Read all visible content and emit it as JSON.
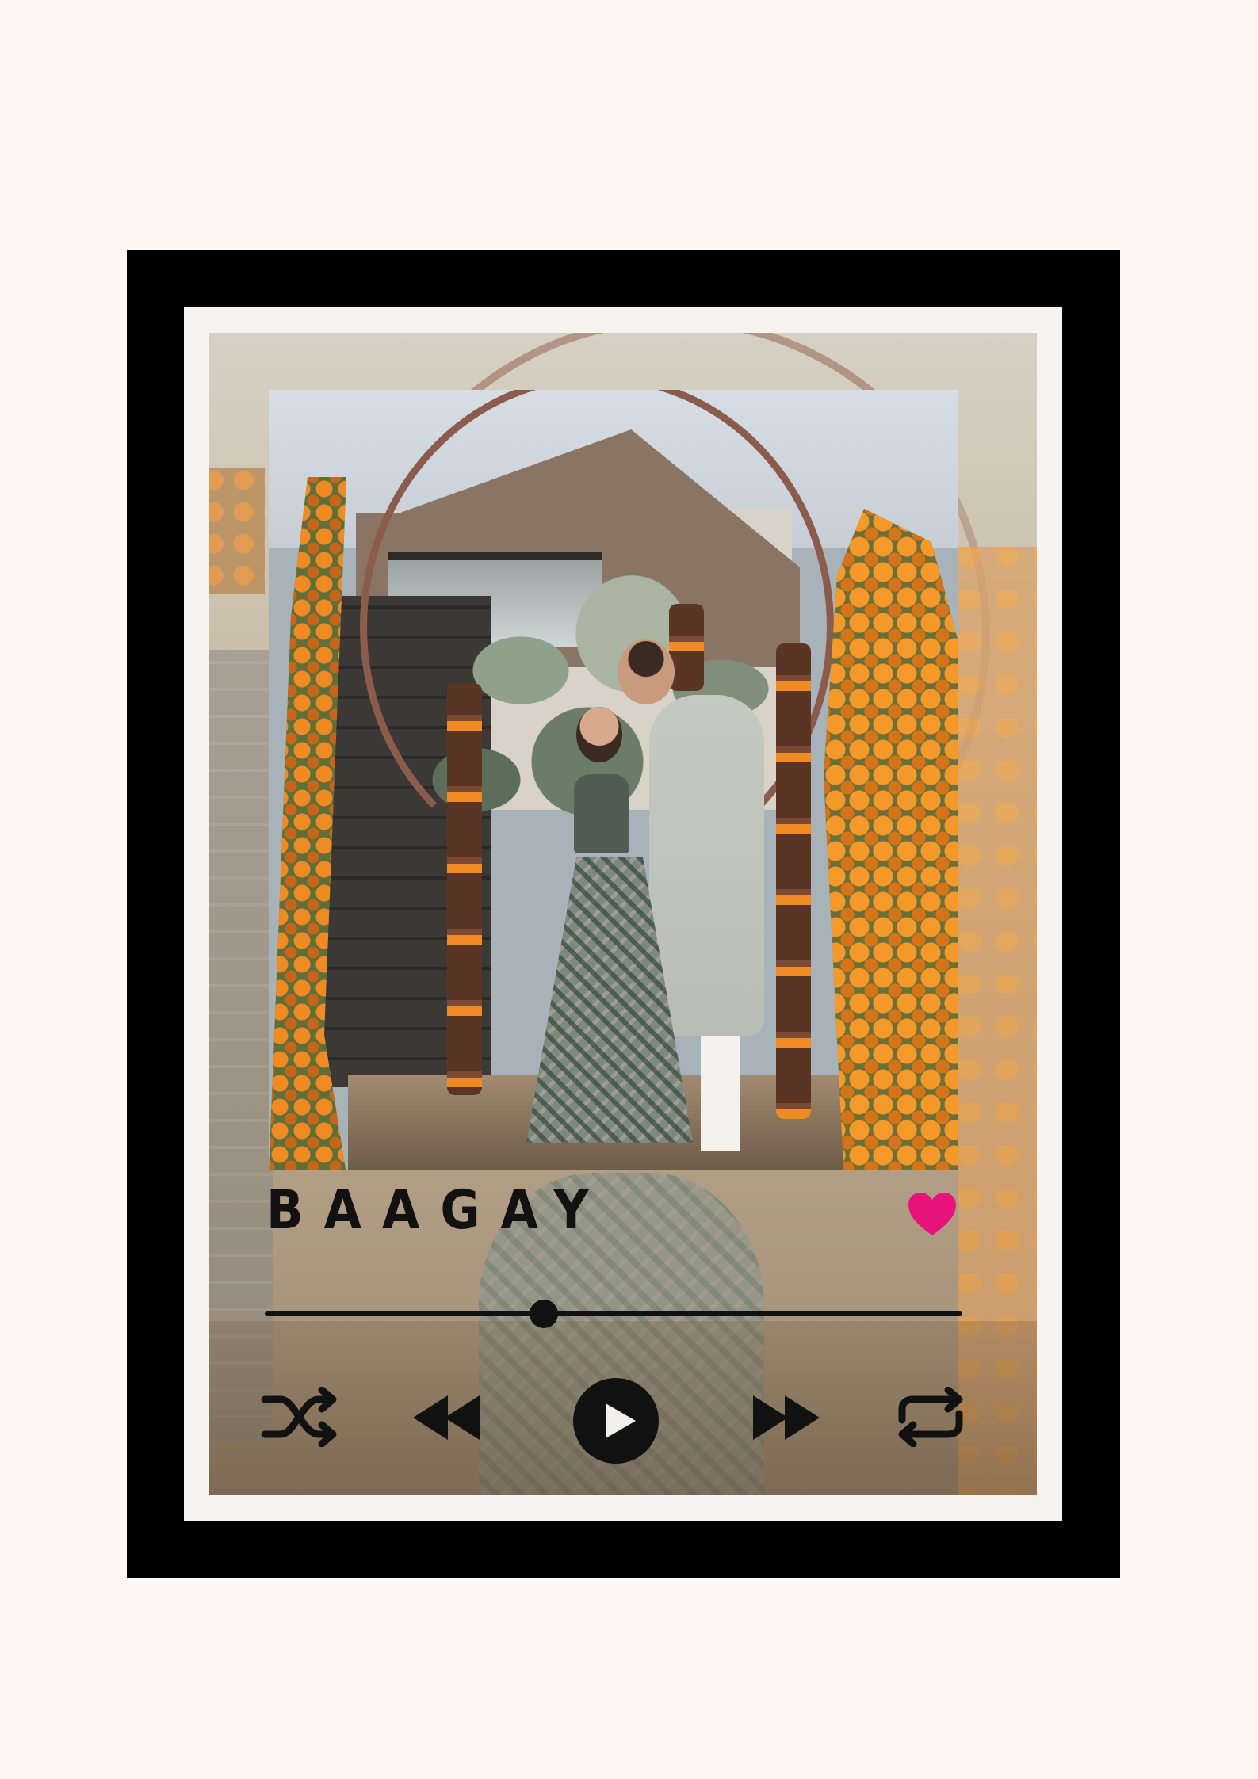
{
  "player": {
    "song_title": "BAAGAY",
    "progress": 0.4,
    "liked": true
  },
  "colors": {
    "frame": "#000000",
    "mat": "#f6f4f1",
    "heart": "#e8137a",
    "controls": "#111111"
  },
  "icons": {
    "shuffle": "shuffle-icon",
    "previous": "previous-icon",
    "play": "play-icon",
    "next": "next-icon",
    "repeat": "repeat-icon",
    "heart": "heart-icon"
  }
}
